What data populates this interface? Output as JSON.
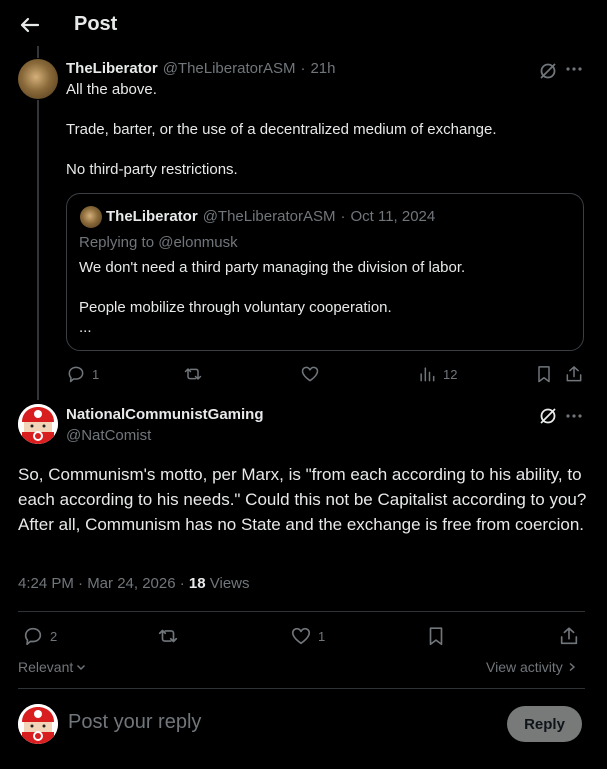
{
  "header": {
    "title": "Post"
  },
  "parent_post": {
    "display_name": "TheLiberator",
    "handle": "@TheLiberatorASM",
    "separator": "·",
    "time": "21h",
    "lines": [
      "All the above.",
      "Trade, barter, or the use of a decentralized medium of exchange.",
      "No third-party restrictions."
    ],
    "quote": {
      "display_name": "TheLiberator",
      "handle": "@TheLiberatorASM",
      "separator": "·",
      "date": "Oct 11, 2024",
      "replying_to": "Replying to @elonmusk",
      "lines": [
        "We don't need a third party managing the division of labor.",
        "People mobilize through voluntary cooperation.",
        "..."
      ]
    },
    "actions": {
      "replies": "1",
      "reposts": "",
      "likes": "",
      "views": "12"
    }
  },
  "main_post": {
    "display_name": "NationalCommunistGaming",
    "handle": "@NatComist",
    "text": "So, Communism's motto, per Marx, is \"from each according to his ability, to each according to his needs.\" Could this not be Capitalist according to you? After all, Communism has no State and the exchange is free from coercion.",
    "timestamp": "4:24 PM · Mar 24, 2026 · ",
    "views_count": "18",
    "views_label": " Views",
    "actions": {
      "replies": "2",
      "reposts": "",
      "likes": "1"
    }
  },
  "filters": {
    "relevant": "Relevant",
    "view_activity": "View activity"
  },
  "composer": {
    "placeholder": "Post your reply",
    "reply_button": "Reply"
  },
  "colors": {
    "background": "#000000",
    "text": "#e7e9ea",
    "muted": "#71767b",
    "divider": "#2f3336",
    "reply_button": "#787a7a"
  }
}
